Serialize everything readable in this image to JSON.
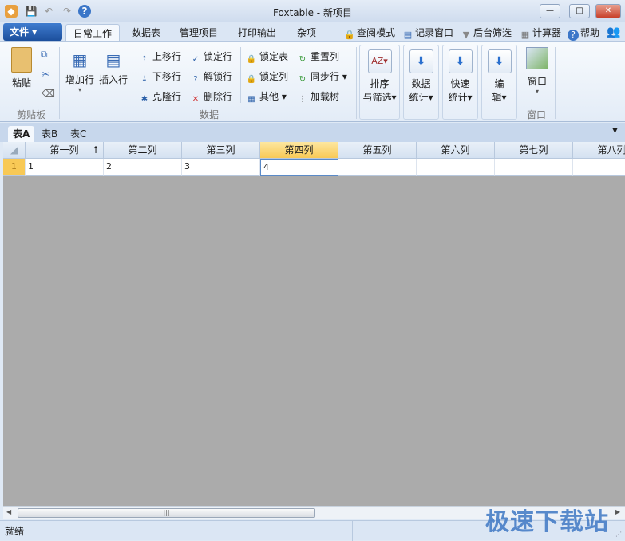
{
  "window": {
    "title": "Foxtable - 新项目",
    "minimize": "—",
    "maximize": "□",
    "close": "✕"
  },
  "qat": {
    "save": "💾",
    "undo": "↶",
    "redo": "↷",
    "help": "?"
  },
  "menu": {
    "file": "文件 ▾",
    "tabs": [
      "日常工作",
      "数据表",
      "管理项目",
      "打印输出",
      "杂项"
    ],
    "right": [
      {
        "label": "查阅模式",
        "icon": "lock-icon"
      },
      {
        "label": "记录窗口",
        "icon": "window-icon"
      },
      {
        "label": "后台筛选",
        "icon": "filter-icon"
      },
      {
        "label": "计算器",
        "icon": "calculator-icon"
      },
      {
        "label": "帮助",
        "icon": "help-icon"
      }
    ]
  },
  "ribbon": {
    "clipboard": {
      "paste": "粘贴",
      "group": "剪贴板"
    },
    "rows": {
      "add": "增加行",
      "insert": "插入行"
    },
    "data": {
      "group": "数据",
      "items": [
        "上移行",
        "锁定行",
        "下移行",
        "解锁行",
        "克隆行",
        "删除行",
        "锁定表",
        "重置列",
        "锁定列",
        "同步行",
        "其他",
        "加载树"
      ]
    },
    "panels": [
      {
        "l1": "排序",
        "l2": "与筛选"
      },
      {
        "l1": "数据",
        "l2": "统计"
      },
      {
        "l1": "快速",
        "l2": "统计"
      },
      {
        "l1": "编",
        "l2": "辑"
      }
    ],
    "window": {
      "label": "窗口",
      "group": "窗口"
    }
  },
  "sheets": [
    "表A",
    "表B",
    "表C"
  ],
  "grid": {
    "columns": [
      "第一列",
      "第二列",
      "第三列",
      "第四列",
      "第五列",
      "第六列",
      "第七列",
      "第八列"
    ],
    "sort_indicator": "↑",
    "selected_column": "第四列",
    "rows": [
      {
        "num": "1",
        "cells": [
          "1",
          "2",
          "3",
          "4",
          "",
          "",
          "",
          ""
        ]
      }
    ]
  },
  "status": {
    "text": "就绪"
  },
  "watermark": "极速下载站",
  "colors": {
    "accent": "#1f5aa6",
    "selected_header": "#f8c956",
    "background": "#ababab"
  }
}
